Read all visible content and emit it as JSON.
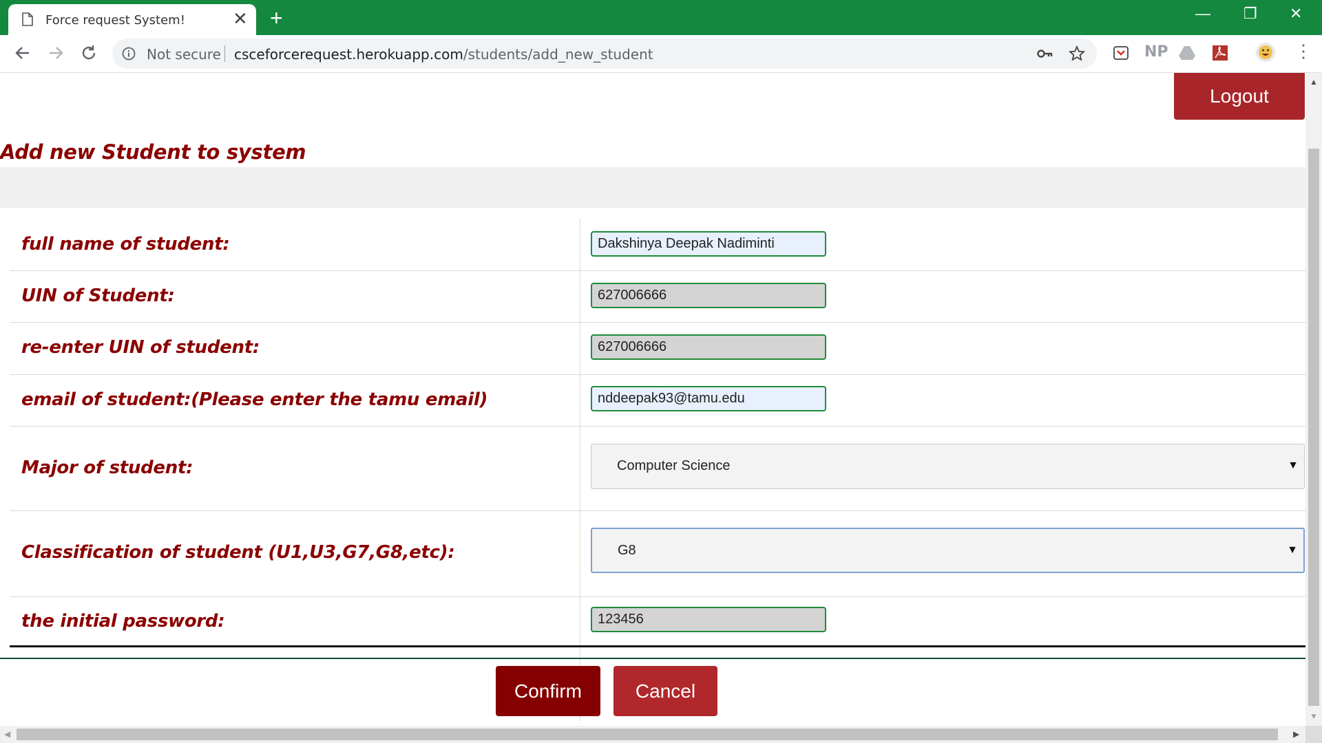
{
  "browser": {
    "tab_title": "Force request System!",
    "tab_close": "✕",
    "new_tab": "+",
    "security_label": "Not secure",
    "url_host": "csceforcerequest.herokuapp.com",
    "url_path": "/students/add_new_student",
    "extensions": [
      "pocket-icon",
      "np-icon",
      "drive-icon",
      "pdf-icon",
      "profile-avatar",
      "menu-icon"
    ],
    "ext_np": "NP",
    "menu": "⋮",
    "win_minimize": "—",
    "win_restore": "❐",
    "win_close": "✕"
  },
  "page": {
    "logout_label": "Logout",
    "title": "Add new Student to system",
    "form": {
      "fields": [
        {
          "label": "full name of student:",
          "value": "Dakshinya Deepak Nadiminti"
        },
        {
          "label": "UIN of Student:",
          "value": "627006666"
        },
        {
          "label": "re-enter UIN of student:",
          "value": "627006666"
        },
        {
          "label": "email of student:(Please enter the tamu email)",
          "value": "nddeepak93@tamu.edu"
        },
        {
          "label": "Major of student:",
          "value": "Computer Science"
        },
        {
          "label": "Classification of student (U1,U3,G7,G8,etc):",
          "value": "G8"
        },
        {
          "label": "the initial password:",
          "value": "123456"
        }
      ],
      "confirm_label": "Confirm",
      "cancel_label": "Cancel",
      "select_caret": "▼"
    }
  },
  "colors": {
    "chrome_green": "#14883e",
    "title_red": "#8b0000",
    "logout_red": "#a8262a",
    "confirm_red": "#850000",
    "cancel_red": "#b0282c",
    "input_border_green": "#1f8a3a"
  }
}
